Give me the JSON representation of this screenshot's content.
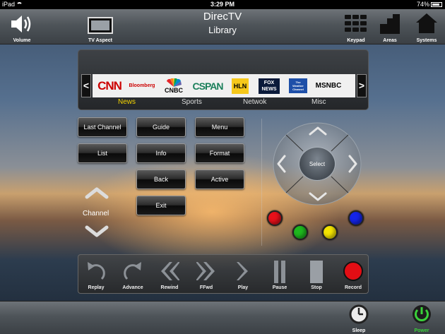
{
  "status": {
    "device": "iPad",
    "time": "3:29 PM",
    "battery": "74%"
  },
  "header": {
    "title": "DirecTV",
    "subtitle": "Library"
  },
  "nav": {
    "volume": "Volume",
    "tv_aspect": "TV Aspect",
    "keypad": "Keypad",
    "areas": "Areas",
    "systems": "Systems"
  },
  "channels": {
    "prev": "<",
    "next": ">",
    "logos": [
      {
        "name": "CNN",
        "text": "CNN",
        "color": "#cc0000"
      },
      {
        "name": "Bloomberg",
        "text": "Bloomberg",
        "color": "#cc0000"
      },
      {
        "name": "CNBC",
        "text": "CNBC",
        "color": "#000000"
      },
      {
        "name": "C-SPAN",
        "text": "CSPAN",
        "color": "#1a7f5a"
      },
      {
        "name": "HLN",
        "text": "HLN",
        "color": "#000000"
      },
      {
        "name": "FOX NEWS",
        "text": "FOX NEWS",
        "color": "#ffffff"
      },
      {
        "name": "The Weather Channel",
        "text": "The Weather Channel",
        "color": "#ffffff"
      },
      {
        "name": "MSNBC",
        "text": "MSNBC",
        "color": "#000000"
      }
    ],
    "categories": [
      "News",
      "Sports",
      "Netwok",
      "Misc"
    ],
    "active_category": "News"
  },
  "buttons": {
    "last_channel": "Last Channel",
    "guide": "Guide",
    "menu": "Menu",
    "list": "List",
    "info": "Info",
    "format": "Format",
    "back": "Back",
    "active": "Active",
    "exit": "Exit"
  },
  "channel_label": "Channel",
  "dpad": {
    "select": "Select"
  },
  "color_buttons": {
    "red": "#e8111a",
    "green": "#1eb81e",
    "yellow": "#f4e400",
    "blue": "#1424e8"
  },
  "transport": {
    "replay": "Replay",
    "advance": "Advance",
    "rewind": "Rewind",
    "ffwd": "FFwd",
    "play": "Play",
    "pause": "Pause",
    "stop": "Stop",
    "record": "Record"
  },
  "bottom": {
    "sleep": "Sleep",
    "power": "Power",
    "power_color": "#3ad13a"
  }
}
